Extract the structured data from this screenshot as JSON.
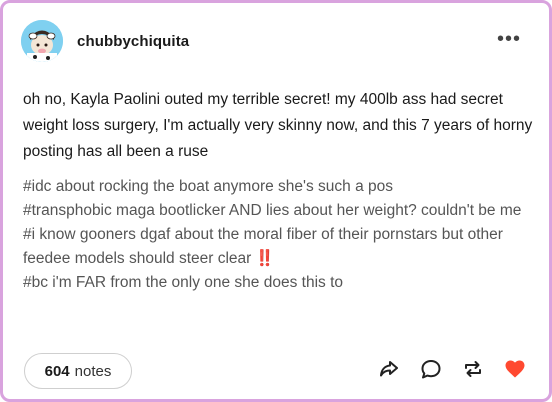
{
  "post": {
    "username": "chubbychiquita",
    "more_label": "•••",
    "body": "oh no, Kayla Paolini outed my terrible secret! my 400lb ass had secret weight loss surgery, I'm actually very skinny now, and this 7 years of horny posting has all been a ruse",
    "tags": [
      "#idc about rocking the boat anymore she's such a pos",
      "#transphobic maga bootlicker AND lies about her weight? couldn't be me",
      "#i know gooners dgaf about the moral fiber of their pornstars but other feedee models should steer clear",
      "#bc i'm FAR from the only one she does this to"
    ],
    "tag_emoji": "‼️",
    "notes_count": "604",
    "notes_label": "notes"
  },
  "icons": {
    "share": "share-icon",
    "reply": "reply-icon",
    "reblog": "reblog-icon",
    "like": "heart-icon"
  },
  "colors": {
    "frame": "#d9a3de",
    "avatar_bg": "#7fd0f0",
    "like": "#ff4930",
    "tag_text": "#555555"
  }
}
